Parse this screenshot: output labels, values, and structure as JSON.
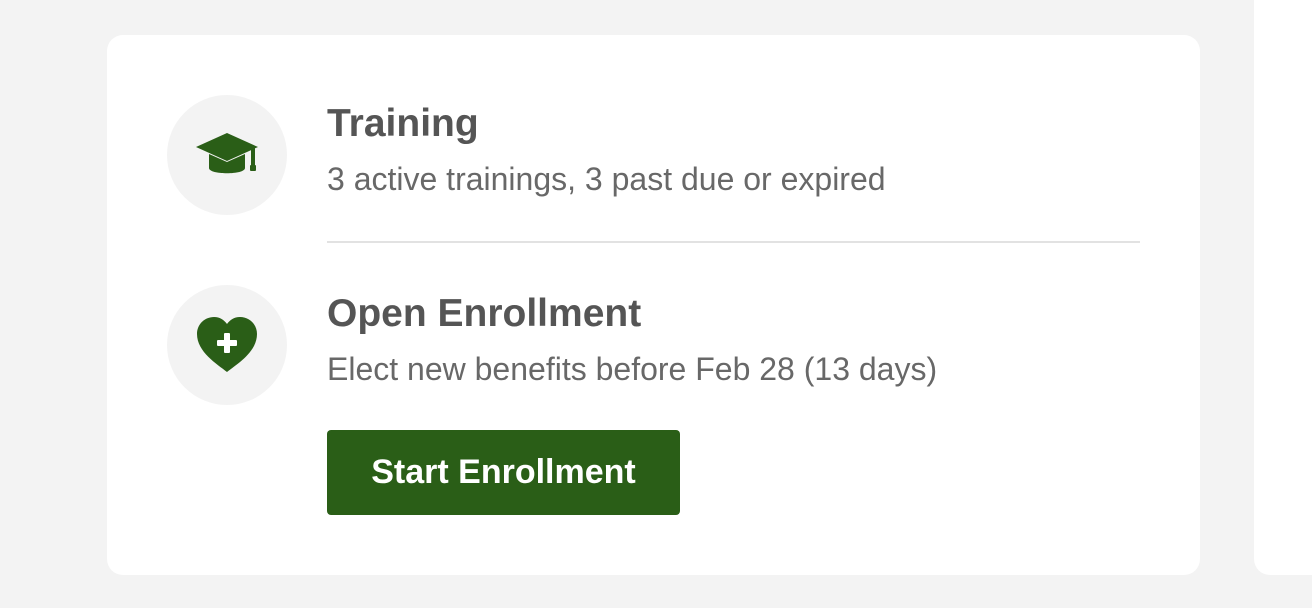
{
  "colors": {
    "accent": "#2a5e17",
    "page_background": "#f3f3f3",
    "card_background": "#ffffff",
    "title_text": "#555555",
    "subtitle_text": "#686868",
    "icon_background": "#f3f3f3"
  },
  "training": {
    "icon": "graduation-cap-icon",
    "title": "Training",
    "subtitle": "3 active trainings, 3 past due or expired"
  },
  "open_enrollment": {
    "icon": "heart-plus-icon",
    "title": "Open Enrollment",
    "subtitle": "Elect new benefits before Feb 28 (13 days)",
    "button_label": "Start Enrollment"
  }
}
